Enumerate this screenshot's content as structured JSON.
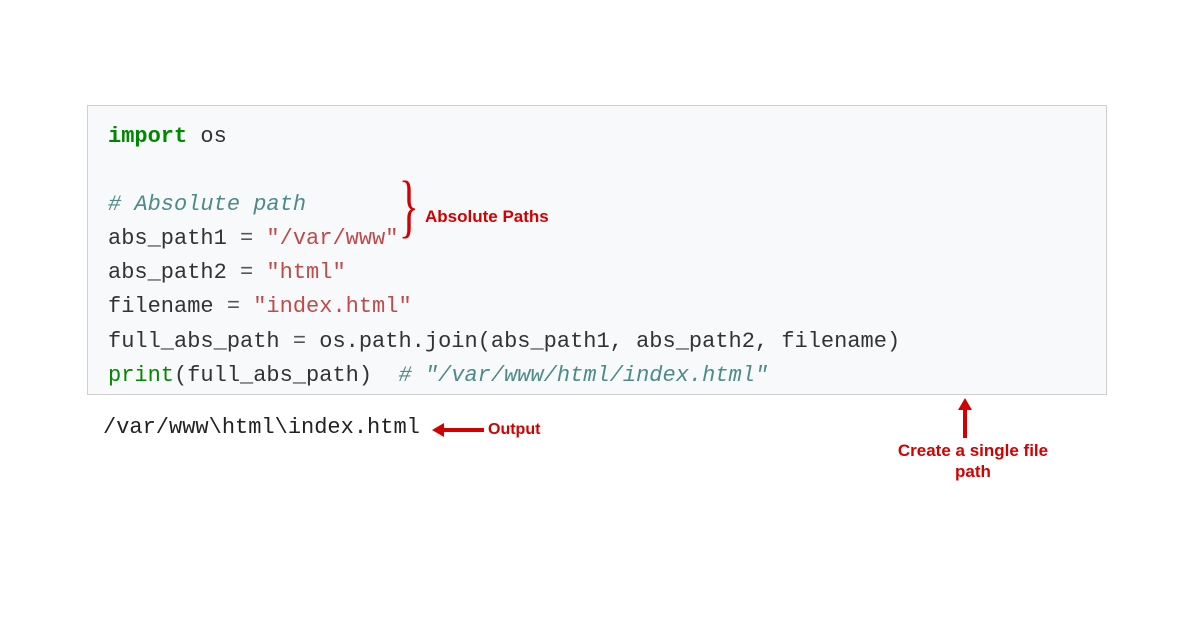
{
  "code": {
    "line1_import": "import",
    "line1_module": " os",
    "line2_blank": "",
    "line3_comment": "# Absolute path",
    "line4_var": "abs_path1 ",
    "line4_eq": "=",
    "line4_str": " \"/var/www\"",
    "line5_var": "abs_path2 ",
    "line5_eq": "=",
    "line5_str": " \"html\"",
    "line6_var": "filename ",
    "line6_eq": "=",
    "line6_str": " \"index.html\"",
    "line7_var": "full_abs_path ",
    "line7_eq": "=",
    "line7_func": " os.path.join(abs_path1, abs_path2, filename)",
    "line8_print": "print",
    "line8_args": "(full_abs_path)  ",
    "line8_comment": "# \"/var/www/html/index.html\""
  },
  "output": "/var/www\\html\\index.html",
  "annotations": {
    "absolute_paths": "Absolute Paths",
    "output_label": "Output",
    "create_path": "Create a single file path"
  }
}
